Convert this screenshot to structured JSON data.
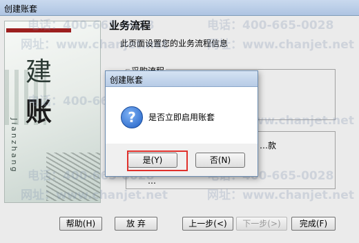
{
  "window": {
    "title": "创建账套"
  },
  "left_panel": {
    "char1": "建",
    "char2": "账",
    "vertical_text": "Jianzhang"
  },
  "main": {
    "heading": "业务流程",
    "subtitle": "此页面设置您的业务流程信息",
    "group1_label": "采购流程",
    "group2_label": "…款",
    "group2_row": "…"
  },
  "buttons": {
    "help": "帮助(H)",
    "abandon": "放 弃",
    "prev": "上一步(<)",
    "next": "下一步(>)",
    "finish": "完成(F)"
  },
  "watermarks": [
    "电话：400-665-0028",
    "网址：www.chanjet.net"
  ],
  "dialog": {
    "title": "创建账套",
    "message": "是否立即启用账套",
    "yes": "是(Y)",
    "no": "否(N)",
    "icon": "question-icon"
  },
  "colors": {
    "highlight": "#e0302b",
    "brand_red": "#9c1f1f"
  }
}
